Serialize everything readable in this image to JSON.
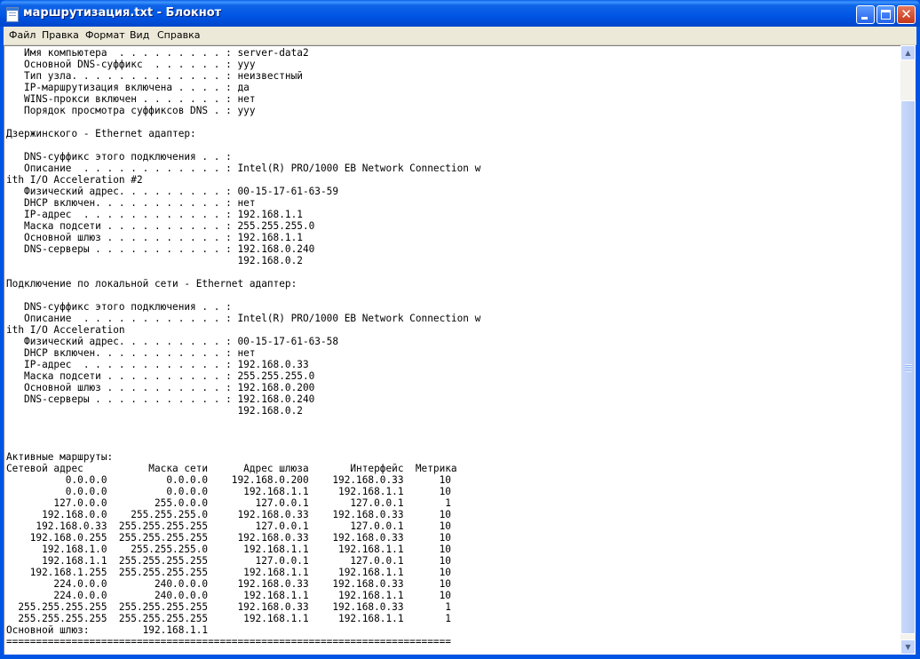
{
  "window": {
    "title": "маршрутизация.txt - Блокнот",
    "accent_color": "#0054E3"
  },
  "titlebar_buttons": {
    "minimize_icon": "minimize-icon",
    "maximize_icon": "maximize-icon",
    "close_icon": "close-icon",
    "close_glyph": "✕"
  },
  "menu": {
    "file": "Файл",
    "edit": "Правка",
    "format": "Формат",
    "view": "Вид",
    "help": "Справка"
  },
  "scrollbar": {
    "up_glyph": "▲",
    "down_glyph": "▼"
  },
  "document": {
    "text": "   Имя компьютера  . . . . . . . . . : server-data2\n   Основной DNS-суффикс  . . . . . . : yyy\n   Тип узла. . . . . . . . . . . . . : неизвестный\n   IP-маршрутизация включена . . . . : да\n   WINS-прокси включен . . . . . . . : нет\n   Порядок просмотра суффиксов DNS . : yyy\n\nДзержинского - Ethernet адаптер:\n\n   DNS-суффикс этого подключения . . :\n   Описание  . . . . . . . . . . . . : Intel(R) PRO/1000 EB Network Connection w\nith I/O Acceleration #2\n   Физический адрес. . . . . . . . . : 00-15-17-61-63-59\n   DHCP включен. . . . . . . . . . . : нет\n   IP-адрес  . . . . . . . . . . . . : 192.168.1.1\n   Маска подсети . . . . . . . . . . : 255.255.255.0\n   Основной шлюз . . . . . . . . . . : 192.168.1.1\n   DNS-серверы . . . . . . . . . . . : 192.168.0.240\n                                       192.168.0.2\n\nПодключение по локальной сети - Ethernet адаптер:\n\n   DNS-суффикс этого подключения . . :\n   Описание  . . . . . . . . . . . . : Intel(R) PRO/1000 EB Network Connection w\nith I/O Acceleration\n   Физический адрес. . . . . . . . . : 00-15-17-61-63-58\n   DHCP включен. . . . . . . . . . . : нет\n   IP-адрес  . . . . . . . . . . . . : 192.168.0.33\n   Маска подсети . . . . . . . . . . : 255.255.255.0\n   Основной шлюз . . . . . . . . . . : 192.168.0.200\n   DNS-серверы . . . . . . . . . . . : 192.168.0.240\n                                       192.168.0.2\n\n\n\nАктивные маршруты:\nСетевой адрес           Маска сети      Адрес шлюза       Интерфейс  Метрика\n          0.0.0.0          0.0.0.0    192.168.0.200    192.168.0.33      10\n          0.0.0.0          0.0.0.0      192.168.1.1     192.168.1.1      10\n        127.0.0.0        255.0.0.0        127.0.0.1       127.0.0.1       1\n      192.168.0.0    255.255.255.0     192.168.0.33    192.168.0.33      10\n     192.168.0.33  255.255.255.255        127.0.0.1       127.0.0.1      10\n    192.168.0.255  255.255.255.255     192.168.0.33    192.168.0.33      10\n      192.168.1.0    255.255.255.0      192.168.1.1     192.168.1.1      10\n      192.168.1.1  255.255.255.255        127.0.0.1       127.0.0.1      10\n    192.168.1.255  255.255.255.255      192.168.1.1     192.168.1.1      10\n        224.0.0.0        240.0.0.0     192.168.0.33    192.168.0.33      10\n        224.0.0.0        240.0.0.0      192.168.1.1     192.168.1.1      10\n  255.255.255.255  255.255.255.255     192.168.0.33    192.168.0.33       1\n  255.255.255.255  255.255.255.255      192.168.1.1     192.168.1.1       1\nОсновной шлюз:         192.168.1.1\n==========================================================================="
  }
}
